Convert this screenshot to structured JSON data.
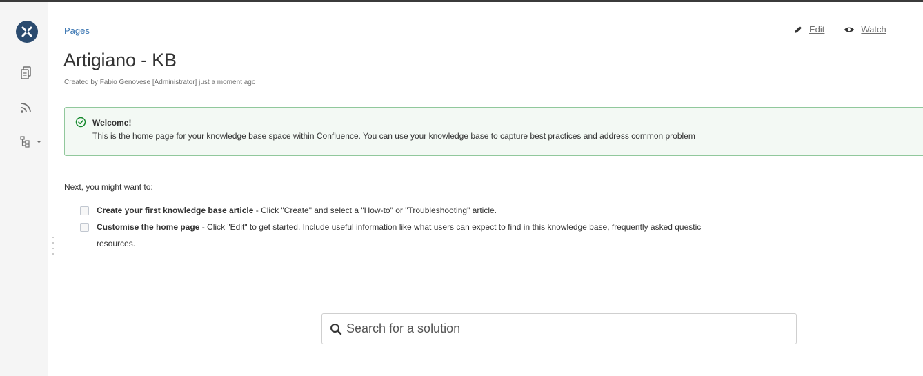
{
  "breadcrumb": {
    "label": "Pages"
  },
  "actions": {
    "edit_label": "Edit",
    "watch_label": "Watch"
  },
  "page": {
    "title": "Artigiano - KB",
    "meta": {
      "created_by": "Created by",
      "author": "Fabio Genovese [Administrator]",
      "time": "just a moment ago"
    }
  },
  "welcome": {
    "title": "Welcome!",
    "body": "This is the home page for your knowledge base space within Confluence. You can use your knowledge base to capture best practices and address common problem"
  },
  "next": {
    "heading": "Next, you might want to:",
    "tasks": [
      {
        "bold": "Create your first knowledge base article",
        "rest": " - Click \"Create\" and select a \"How-to\" or \"Troubleshooting\" article."
      },
      {
        "bold": "Customise the home page",
        "rest": " - Click \"Edit\" to get started. Include useful information like what users can expect to find in this knowledge base, frequently asked questic",
        "continuation": "resources."
      }
    ]
  },
  "search": {
    "placeholder": "Search for a solution"
  },
  "sidebar": {
    "icons": [
      "space-logo-icon",
      "pages-icon",
      "rss-feed-icon",
      "page-tree-icon"
    ]
  },
  "colors": {
    "link": "#3572b0",
    "space_logo": "#2b4b6f",
    "success_border": "#91c89c",
    "success_bg": "#f3f9f4",
    "success_icon": "#14892c"
  }
}
